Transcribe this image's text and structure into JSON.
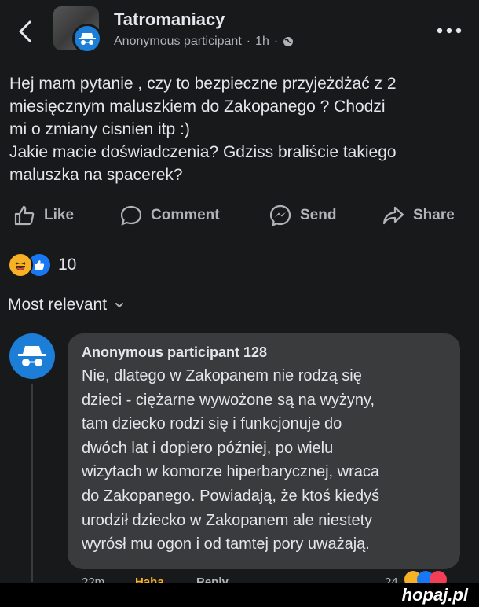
{
  "header": {
    "group_name": "Tatromaniacy",
    "author": "Anonymous participant",
    "separator": "·",
    "time": "1h",
    "separator2": "·"
  },
  "post": {
    "lines": [
      "Hej mam pytanie , czy to bezpieczne przyjeżdżać z 2",
      "miesięcznym  maluszkiem do Zakopanego ? Chodzi",
      "mi o zmiany cisnien itp :)",
      "Jakie macie doświadczenia? Gdziss braliście takiego",
      "maluszka na spacerek?"
    ]
  },
  "actions": {
    "like": "Like",
    "comment": "Comment",
    "send": "Send",
    "share": "Share"
  },
  "reactions": {
    "count": "10",
    "types": [
      "haha",
      "like"
    ]
  },
  "sort": {
    "label": "Most relevant"
  },
  "comment": {
    "author": "Anonymous participant 128",
    "lines": [
      "Nie, dlatego w Zakopanem nie rodzą się",
      "dzieci - ciężarne wywożone są na wyżyny,",
      "tam dziecko rodzi się i funkcjonuje do",
      "dwóch lat i dopiero później, po wielu",
      "wizytach w komorze hiperbarycznej, wraca",
      "do Zakopanego. Powiadają, że ktoś kiedyś",
      "urodził dziecko w Zakopanem ale niestety",
      "wyrósł mu ogon i od tamtej pory uważają."
    ],
    "footer": {
      "time": "22m",
      "haha": "Haha",
      "reply": "Reply",
      "count": "24"
    }
  },
  "watermark": {
    "text": "hopaj",
    "dot": ".",
    "tld": "pl"
  },
  "colors": {
    "background": "#18191a",
    "bubble": "#3a3b3c",
    "accent_blue": "#1c7ed6",
    "muted_text": "#b0b3b8"
  }
}
